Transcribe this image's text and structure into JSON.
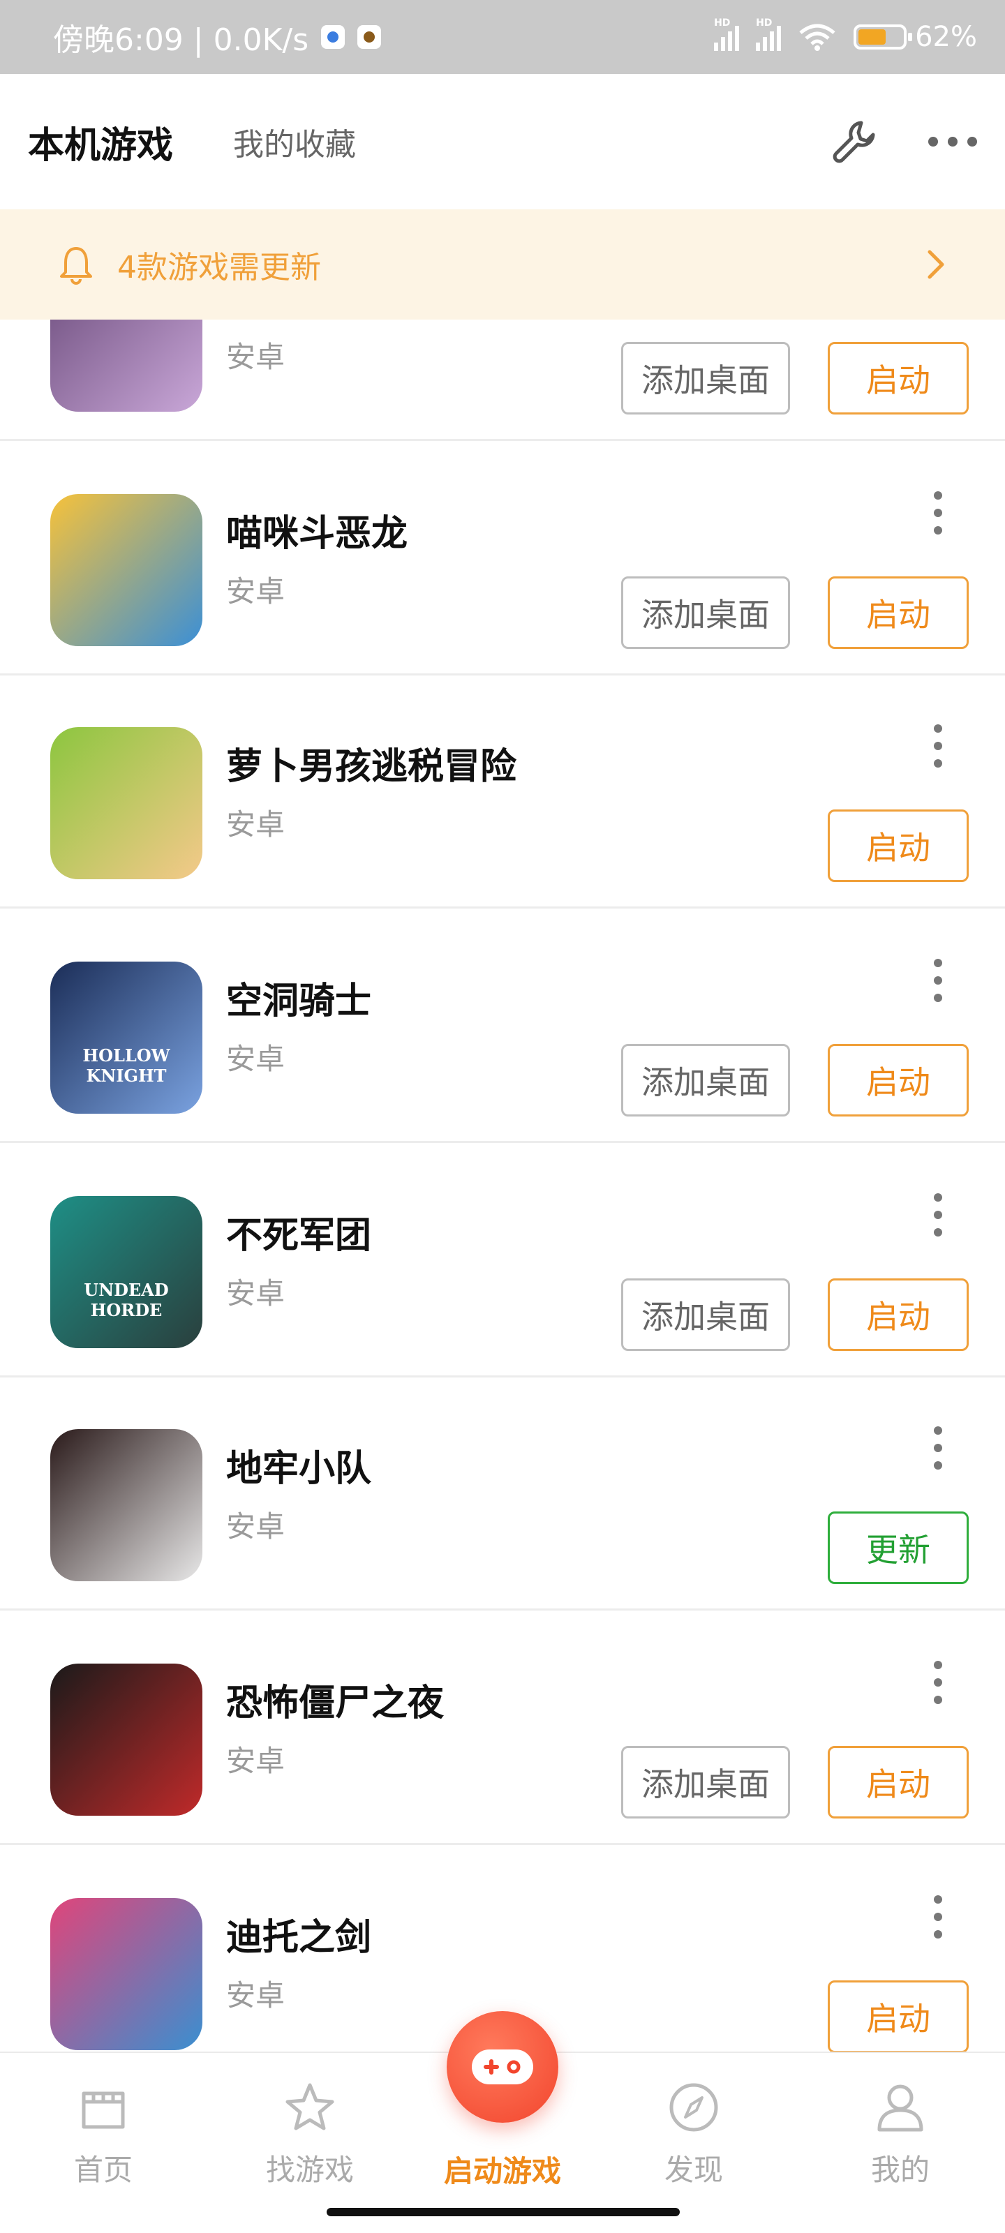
{
  "status_bar": {
    "time_speed": "傍晚6:09 | 0.0K/s",
    "battery": "62%",
    "battery_level": 0.62
  },
  "header": {
    "active_tab": "本机游戏",
    "tab2": "我的收藏"
  },
  "banner": {
    "text": "4款游戏需更新"
  },
  "games": [
    {
      "title": "",
      "platform": "安卓",
      "desktop_label": "添加桌面",
      "action_label": "启动",
      "icon": "fantasy-character-icon",
      "colors": [
        "#6a4a7a",
        "#c9a7d8"
      ]
    },
    {
      "title": "喵咪斗恶龙",
      "platform": "安卓",
      "desktop_label": "添加桌面",
      "action_label": "启动",
      "icon": "yellow-cat-knight-icon",
      "colors": [
        "#f7c23a",
        "#3b8fd6"
      ]
    },
    {
      "title": "萝卜男孩逃税冒险",
      "platform": "安卓",
      "desktop_label": "",
      "action_label": "启动",
      "icon": "turnip-boy-icon",
      "colors": [
        "#8cc63f",
        "#f4c98a"
      ]
    },
    {
      "title": "空洞骑士",
      "platform": "安卓",
      "desktop_label": "添加桌面",
      "action_label": "启动",
      "icon": "hollow-knight-icon",
      "colors": [
        "#1b2d57",
        "#7aa2e0"
      ],
      "icon_text": "HOLLOW KNIGHT"
    },
    {
      "title": "不死军团",
      "platform": "安卓",
      "desktop_label": "添加桌面",
      "action_label": "启动",
      "icon": "undead-horde-icon",
      "colors": [
        "#1e8f86",
        "#2a3f3d"
      ],
      "icon_text": "UNDEAD HORDE"
    },
    {
      "title": "地牢小队",
      "platform": "安卓",
      "desktop_label": "",
      "action_label": "更新",
      "action_type": "update",
      "icon": "pixel-girl-icon",
      "colors": [
        "#2a1a1a",
        "#e8e8e8"
      ]
    },
    {
      "title": "恐怖僵尸之夜",
      "platform": "安卓",
      "desktop_label": "添加桌面",
      "action_label": "启动",
      "icon": "zombie-hand-icon",
      "colors": [
        "#1a1a1a",
        "#c02a2a"
      ]
    },
    {
      "title": "迪托之剑",
      "platform": "安卓",
      "desktop_label": "",
      "action_label": "启动",
      "icon": "ditto-sword-icon",
      "colors": [
        "#e0457a",
        "#3a8fd0"
      ]
    }
  ],
  "bottom_nav": {
    "home": "首页",
    "find": "找游戏",
    "launch": "启动游戏",
    "discover": "发现",
    "mine": "我的"
  },
  "colors": {
    "accent_orange": "#ef8a1a",
    "update_green": "#23a033",
    "banner_bg": "#fdf4e4",
    "center_button": "#f2452d"
  }
}
